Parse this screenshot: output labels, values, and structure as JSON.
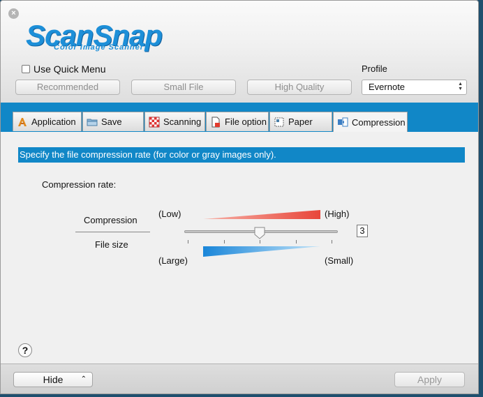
{
  "window": {
    "close_label": "×"
  },
  "logo": {
    "name": "ScanSnap",
    "tagline": "Color Image Scanner"
  },
  "header": {
    "quick_menu_label": "Use Quick Menu",
    "quick_menu_checked": false,
    "presets": [
      "Recommended",
      "Small File",
      "High Quality"
    ],
    "profile_label": "Profile",
    "profile_value": "Evernote"
  },
  "tabs": [
    {
      "label": "Application",
      "icon": "application-icon",
      "active": false
    },
    {
      "label": "Save",
      "icon": "folder-icon",
      "active": false
    },
    {
      "label": "Scanning",
      "icon": "scanning-icon",
      "active": false
    },
    {
      "label": "File option",
      "icon": "file-icon",
      "active": false
    },
    {
      "label": "Paper",
      "icon": "paper-icon",
      "active": false
    },
    {
      "label": "Compression",
      "icon": "compression-icon",
      "active": true
    }
  ],
  "compression": {
    "description": "Specify the file compression rate (for color or gray images only).",
    "rate_label": "Compression rate:",
    "compression_label": "Compression",
    "file_size_label": "File size",
    "low_label": "(Low)",
    "high_label": "(High)",
    "large_label": "(Large)",
    "small_label": "(Small)",
    "slider_min": 1,
    "slider_max": 5,
    "value": 3,
    "value_text": "3",
    "colors": {
      "compression_bar": "#e8463a",
      "file_size_bar": "#1a86d9",
      "accent": "#1187c7"
    }
  },
  "footer": {
    "help_label": "?",
    "hide_label": "Hide",
    "hide_chevron": "⌃",
    "apply_label": "Apply"
  }
}
